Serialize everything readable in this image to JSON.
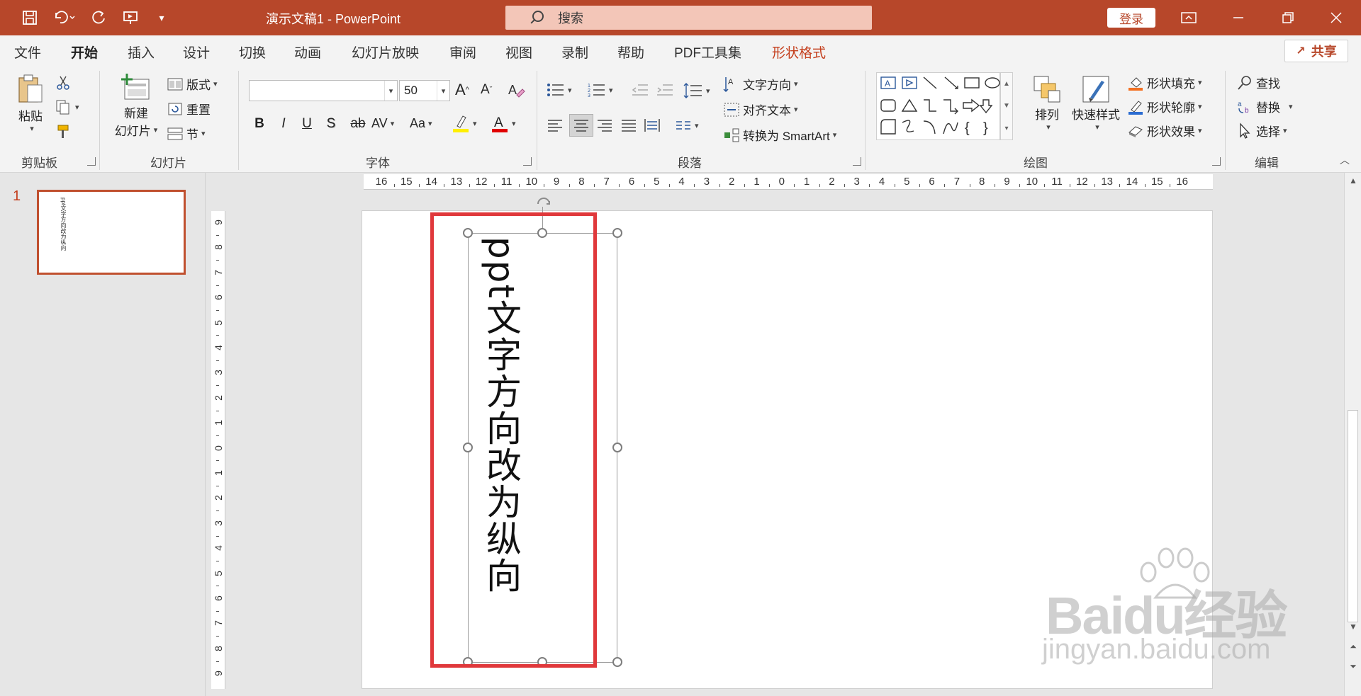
{
  "title_bar": {
    "doc_title": "演示文稿1  -  PowerPoint",
    "search_placeholder": "搜索",
    "login_label": "登录",
    "quick_access": [
      "save-icon",
      "undo-icon",
      "redo-icon",
      "present-icon",
      "customize-icon"
    ]
  },
  "tabs": [
    {
      "label": "文件"
    },
    {
      "label": "开始"
    },
    {
      "label": "插入"
    },
    {
      "label": "设计"
    },
    {
      "label": "切换"
    },
    {
      "label": "动画"
    },
    {
      "label": "幻灯片放映"
    },
    {
      "label": "审阅"
    },
    {
      "label": "视图"
    },
    {
      "label": "录制"
    },
    {
      "label": "帮助"
    },
    {
      "label": "PDF工具集"
    },
    {
      "label": "形状格式"
    }
  ],
  "active_tab": "开始",
  "share_label": "共享",
  "ribbon": {
    "clipboard": {
      "group": "剪贴板",
      "paste": "粘贴"
    },
    "slides": {
      "group": "幻灯片",
      "new_slide_1": "新建",
      "new_slide_2": "幻灯片",
      "layout": "版式",
      "reset": "重置",
      "section": "节"
    },
    "font": {
      "group": "字体",
      "font_name": "",
      "font_size": "50",
      "bold": "B",
      "italic": "I",
      "underline": "U",
      "shadow": "S",
      "strike": "ab",
      "spacing": "AV",
      "case": "Aa",
      "grow": "A",
      "shrink": "A"
    },
    "paragraph": {
      "group": "段落",
      "text_direction": "文字方向",
      "align_text": "对齐文本",
      "smartart": "转换为 SmartArt"
    },
    "drawing": {
      "group": "绘图",
      "arrange": "排列",
      "quick_styles": "快速样式",
      "fill": "形状填充",
      "outline": "形状轮廓",
      "effects": "形状效果"
    },
    "editing": {
      "group": "编辑",
      "find": "查找",
      "replace": "替换",
      "select": "选择"
    }
  },
  "slide_pane": {
    "number": "1",
    "thumb_text": "ppt文字方向改为纵向"
  },
  "slide": {
    "text": "ppt文字方向改为纵向"
  },
  "hruler_labels": [
    "16",
    "15",
    "14",
    "13",
    "12",
    "11",
    "10",
    "9",
    "8",
    "7",
    "6",
    "5",
    "4",
    "3",
    "2",
    "1",
    "0",
    "1",
    "2",
    "3",
    "4",
    "5",
    "6",
    "7",
    "8",
    "9",
    "10",
    "11",
    "12",
    "13",
    "14",
    "15",
    "16"
  ],
  "vruler_labels": [
    "9",
    "8",
    "7",
    "6",
    "5",
    "4",
    "3",
    "2",
    "1",
    "0",
    "1",
    "2",
    "3",
    "4",
    "5",
    "6",
    "7",
    "8",
    "9"
  ],
  "watermark": {
    "brand": "Baidu经验",
    "site": "jingyan.baidu.com"
  },
  "colors": {
    "accent": "#b7472a",
    "highlight_box": "#e0383b"
  }
}
